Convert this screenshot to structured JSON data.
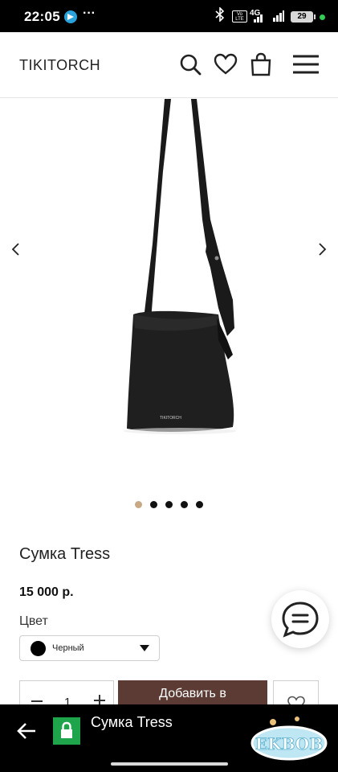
{
  "status_bar": {
    "time": "22:05",
    "network": "4G",
    "volte": "Vo LTE",
    "battery": "29",
    "more": "···"
  },
  "header": {
    "logo": "TIKITORCH",
    "icons": [
      "search-icon",
      "heart-icon",
      "bag-icon",
      "menu-icon"
    ]
  },
  "gallery": {
    "total_slides": 5,
    "active_slide": 1,
    "bag_brand_label": "TIKITORCH"
  },
  "product": {
    "title": "Сумка Tress",
    "price": "15 000 р.",
    "color_label": "Цвет",
    "color_value": "Черный",
    "quantity": "1",
    "add_button_label": "Добавить в"
  },
  "browser_bar": {
    "page_title": "Сумка Tress"
  },
  "watermark": {
    "text": "EKBOB"
  },
  "colors": {
    "accent_brown": "#5b3b33",
    "active_dot": "#c8a985",
    "lock_green": "#1ea44a"
  }
}
